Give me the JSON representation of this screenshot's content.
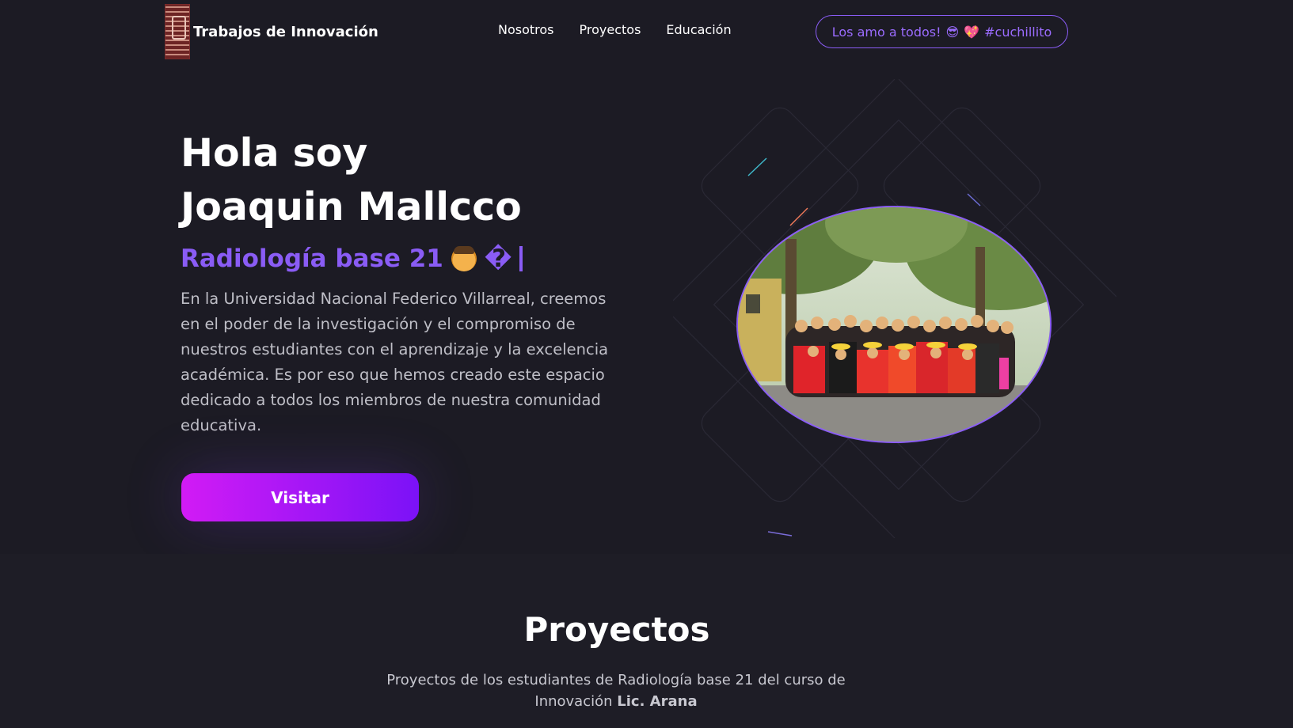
{
  "nav": {
    "brand": "Trabajos de Innovación",
    "links": [
      "Nosotros",
      "Proyectos",
      "Educación"
    ],
    "pill_text": "Los amo a todos!",
    "pill_emoji_1": "😎",
    "pill_emoji_2": "💖",
    "pill_tag": "#cuchillito"
  },
  "hero": {
    "title_line1": "Hola soy",
    "title_line2": "Joaquin Mallcco",
    "subtitle": "Radiología base 21",
    "subtitle_glyph": "�",
    "description": "En la Universidad Nacional Federico Villarreal, creemos en el poder de la investigación y el compromiso de nuestros estudiantes con el aprendizaje y la excelencia académica. Es por eso que hemos creado este espacio dedicado a todos los miembros de nuestra comunidad educativa.",
    "cta_label": "Visitar"
  },
  "projects": {
    "title": "Proyectos",
    "desc_prefix": "Proyectos de los estudiantes de Radiología base 21 del curso de Innovación",
    "desc_bold": "Lic. Arana"
  },
  "colors": {
    "background": "#1c1b24",
    "accent": "#8a5cf5",
    "cta_start": "#d21bf5",
    "cta_end": "#7b12f7"
  }
}
